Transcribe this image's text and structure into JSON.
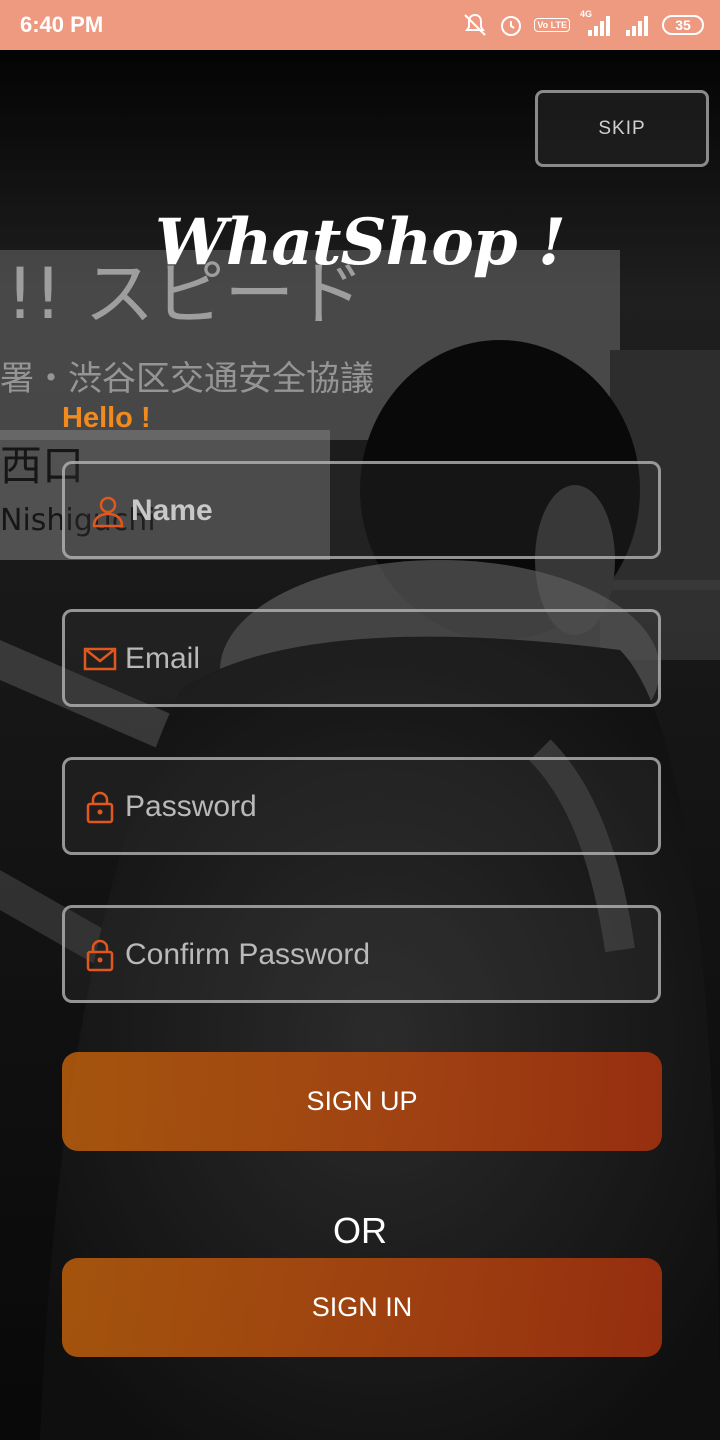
{
  "status_bar": {
    "time": "6:40 PM",
    "volte": "Vo LTE",
    "network": "4G",
    "battery": "35",
    "icons": [
      "mute-icon",
      "alarm-icon",
      "volte-icon",
      "signal-icon",
      "signal-icon",
      "battery-icon"
    ]
  },
  "header": {
    "skip_label": "SKIP",
    "logo": "WhatShop !"
  },
  "form": {
    "greeting": "Hello !",
    "name_placeholder": "Name",
    "email_placeholder": "Email",
    "password_placeholder": "Password",
    "confirm_password_placeholder": "Confirm Password"
  },
  "actions": {
    "sign_up_label": "SIGN UP",
    "or_label": "OR",
    "sign_in_label": "SIGN IN"
  },
  "background": {
    "sign_text_line1": "!! スピード ",
    "sign_text_line2": "署・渋谷区交通安全協議",
    "sign_text_line3": "西口",
    "sign_text_line4": "Nishiguchi"
  },
  "colors": {
    "status_bar": "#ee9a80",
    "accent_orange": "#f28a1e",
    "button_gradient_start": "#c4620c",
    "button_gradient_end": "#b2340e",
    "icon_orange": "#e2581c"
  }
}
